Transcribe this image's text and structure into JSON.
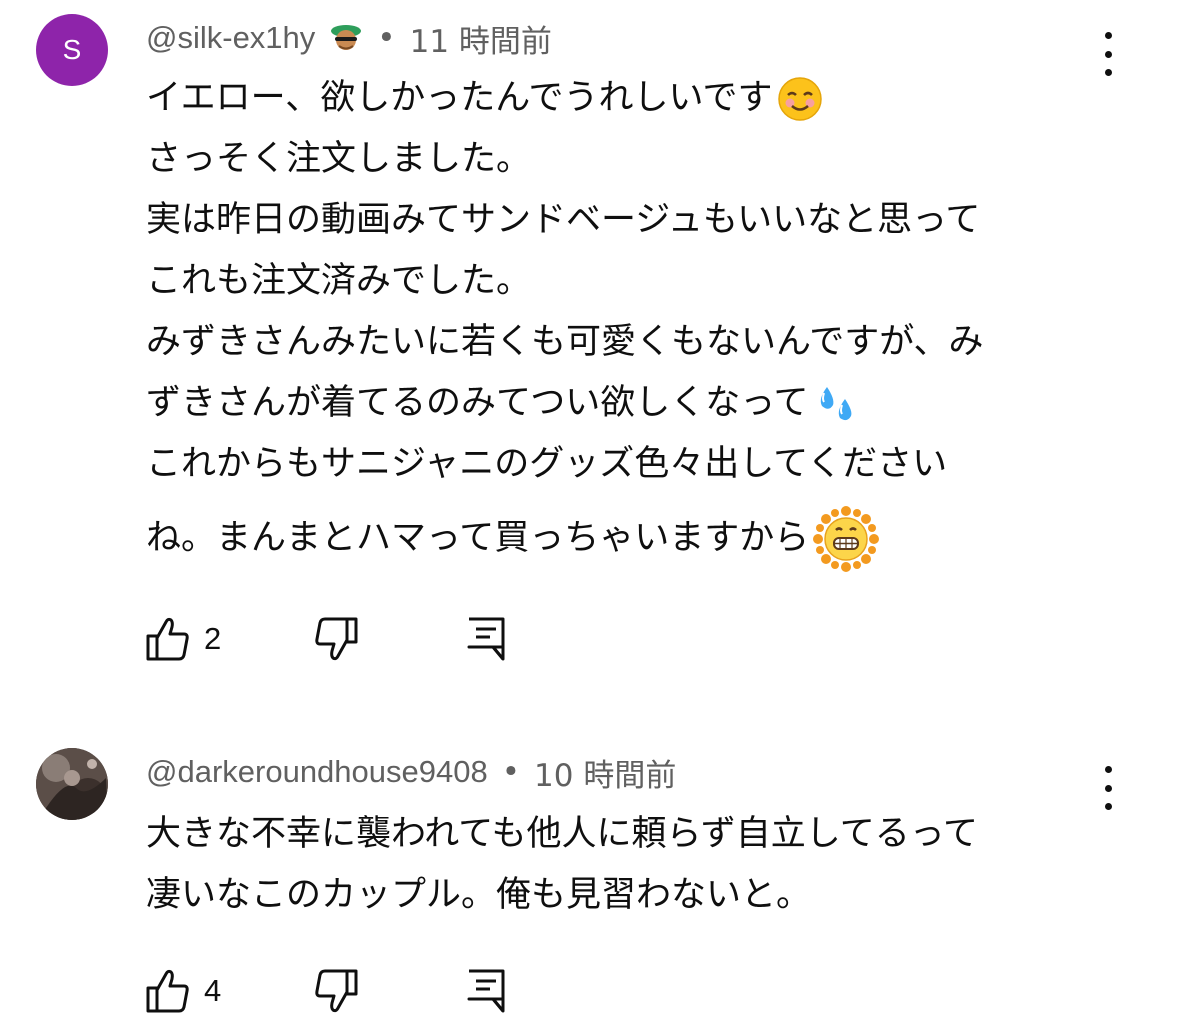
{
  "comments": [
    {
      "avatar_letter": "S",
      "avatar_color": "#8e24aa",
      "handle": "@silk-ex1hy",
      "separator": "•",
      "time": "11 時間前",
      "lines": [
        "イエロー、欲しかったんでうれしいです",
        "さっそく注文しました。",
        "実は昨日の動画みてサンドベージュもいいなと思って",
        "これも注文済みでした。",
        "みずきさんみたいに若くも可愛くもないんですが、み",
        "ずきさんが着てるのみてつい欲しくなって",
        "これからもサニジャニのグッズ色々出してください",
        "ね。まんまとハマって買っちゃいますから"
      ],
      "line_emojis": [
        "smiling-face",
        "",
        "",
        "",
        "",
        "sweat-droplets",
        "",
        "sun-grinning"
      ],
      "likes": "2"
    },
    {
      "handle": "@darkeroundhouse9408",
      "separator": "•",
      "time": "10 時間前",
      "lines": [
        "大きな不幸に襲われても他人に頼らず自立してるって",
        "凄いなこのカップル。俺も見習わないと。"
      ],
      "likes": "4"
    }
  ],
  "icons": {
    "like": "thumbs-up-icon",
    "dislike": "thumbs-down-icon",
    "reply": "reply-icon",
    "menu": "more-vert-icon",
    "badge": "member-badge-icon"
  }
}
